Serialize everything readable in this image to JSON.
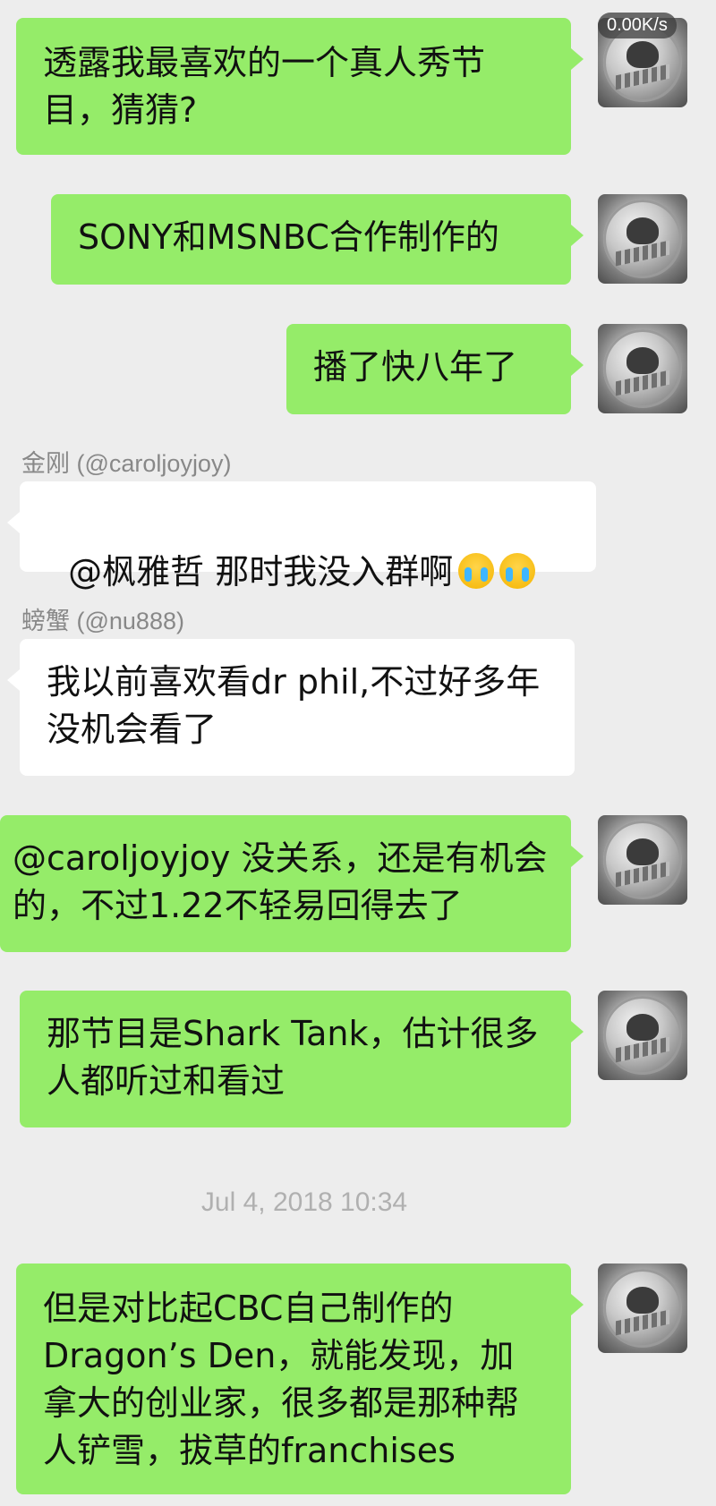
{
  "status": {
    "net_speed": "0.00K/s"
  },
  "messages": [
    {
      "text": "透露我最喜欢的一个真人秀节目，猜猜?"
    },
    {
      "text": "SONY和MSNBC合作制作的"
    },
    {
      "text": "播了快八年了"
    },
    {
      "sender": "金刚 (@caroljoyjoy)",
      "text": "@枫雅哲 那时我没入群啊",
      "emoji": "crying-face"
    },
    {
      "sender": "螃蟹 (@nu888)",
      "text": "我以前喜欢看dr phil,不过好多年没机会看了"
    },
    {
      "text": "@caroljoyjoy 没关系，还是有机会的，不过1.22不轻易回得去了"
    },
    {
      "text": "那节目是Shark Tank，估计很多人都听过和看过"
    },
    {
      "text": "但是对比起CBC自己制作的Dragon’s Den，就能发现，加拿大的创业家，很多都是那种帮人铲雪，拔草的franchises"
    }
  ],
  "timestamp": "Jul 4, 2018 10:34",
  "colors": {
    "outgoing_bubble": "#95ec69",
    "incoming_bubble": "#ffffff",
    "background": "#ededed"
  }
}
